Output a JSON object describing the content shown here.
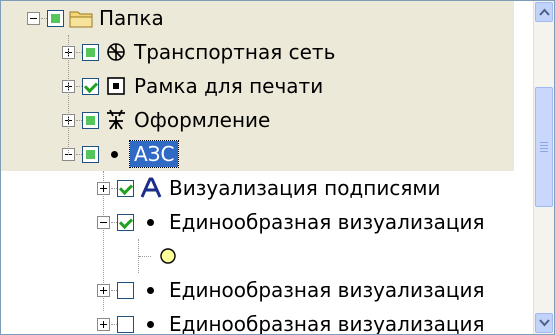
{
  "tree": {
    "items": [
      {
        "label": "Папка",
        "state": "partial",
        "expander": "minus",
        "icon": "folder-icon"
      },
      {
        "label": "Транспортная сеть",
        "state": "partial",
        "expander": "plus",
        "icon": "network-icon"
      },
      {
        "label": "Рамка для печати",
        "state": "checked",
        "expander": "plus",
        "icon": "frame-icon"
      },
      {
        "label": "Оформление",
        "state": "partial",
        "expander": "plus",
        "icon": "styling-icon"
      },
      {
        "label": "АЗС",
        "state": "partial",
        "expander": "minus",
        "icon": "point-bullet-icon",
        "selected": true
      },
      {
        "label": "Визуализация подписями",
        "state": "checked",
        "expander": "plus",
        "icon": "text-label-icon"
      },
      {
        "label": "Единообразная визуализация",
        "state": "checked",
        "expander": "minus",
        "icon": "point-bullet-icon"
      },
      {
        "label": "",
        "icon": "yellow-circle-symbol-icon"
      },
      {
        "label": "Единообразная визуализация",
        "state": "unchecked",
        "expander": "plus",
        "icon": "point-bullet-icon"
      },
      {
        "label": "Единообразная визуализация",
        "state": "unchecked",
        "expander": "plus",
        "icon": "point-bullet-icon"
      }
    ]
  },
  "colors": {
    "band": "#ece9d8",
    "selection": "#316ac5",
    "check_green": "#21a121",
    "symbol_fill": "#ffff99"
  }
}
